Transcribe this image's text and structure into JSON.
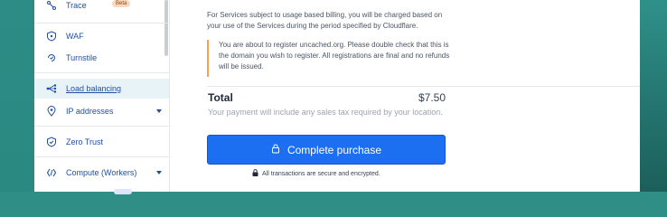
{
  "sidebar": {
    "items": [
      {
        "label": "Trace",
        "badge": "Beta",
        "icon": "trace-icon"
      },
      {
        "label": "WAF",
        "icon": "waf-icon"
      },
      {
        "label": "Turnstile",
        "icon": "turnstile-icon"
      },
      {
        "label": "Load balancing",
        "icon": "load-balancing-icon",
        "active": true
      },
      {
        "label": "IP addresses",
        "icon": "ip-addresses-icon",
        "expandable": true
      },
      {
        "label": "Zero Trust",
        "icon": "zero-trust-icon"
      },
      {
        "label": "Compute (Workers)",
        "icon": "compute-icon",
        "expandable": true
      }
    ]
  },
  "main": {
    "billing_text": "For Services subject to usage based billing, you will be charged based on your use of the Services during the period specified by Cloudflare.",
    "warning_text": "You are about to register uncached.org. Please double check that this is the domain you wish to register. All registrations are final and no refunds will be issued.",
    "total_label": "Total",
    "total_price": "$7.50",
    "tax_note": "Your payment will include any sales tax required by your location.",
    "purchase_button": "Complete purchase",
    "secure_note": "All transactions are secure and encrypted."
  },
  "colors": {
    "accent": "#1d6ff2",
    "link": "#1f4f9e",
    "warning_border": "#f5a257",
    "active_bg": "#e8f3f8"
  }
}
